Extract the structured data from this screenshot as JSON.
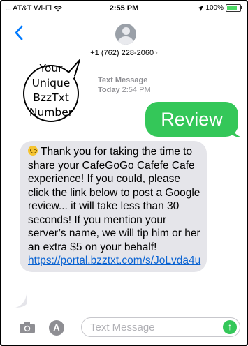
{
  "status_bar": {
    "carrier": "AT&T Wi-Fi",
    "time": "2:55 PM",
    "battery": "100%"
  },
  "header": {
    "phone_number": "+1 (762) 228-2060",
    "chevron": "›"
  },
  "callout": {
    "lines": [
      "Your",
      "Unique",
      "BzzTxt",
      "Number"
    ]
  },
  "conversation": {
    "meta_label": "Text Message",
    "meta_day": "Today",
    "meta_time": "2:54 PM",
    "sent_message": "Review",
    "received_message": "Thank you for taking the time to share your CafeGoGo Cafefe Cafe experience! If you could, please click the link below to post a Google review... it will take less than 30 seconds! If you mention your server’s name, we will tip him or her an extra $5 on your behalf! ",
    "received_link": "https://portal.bzztxt.com/s/JoLvda4u"
  },
  "composer": {
    "placeholder": "Text Message",
    "app_glyph": "A",
    "send_glyph": "↑"
  },
  "colors": {
    "sent_bubble": "#34c759",
    "received_bubble": "#e5e5ea",
    "link": "#0a63d2",
    "back_arrow": "#007aff"
  }
}
